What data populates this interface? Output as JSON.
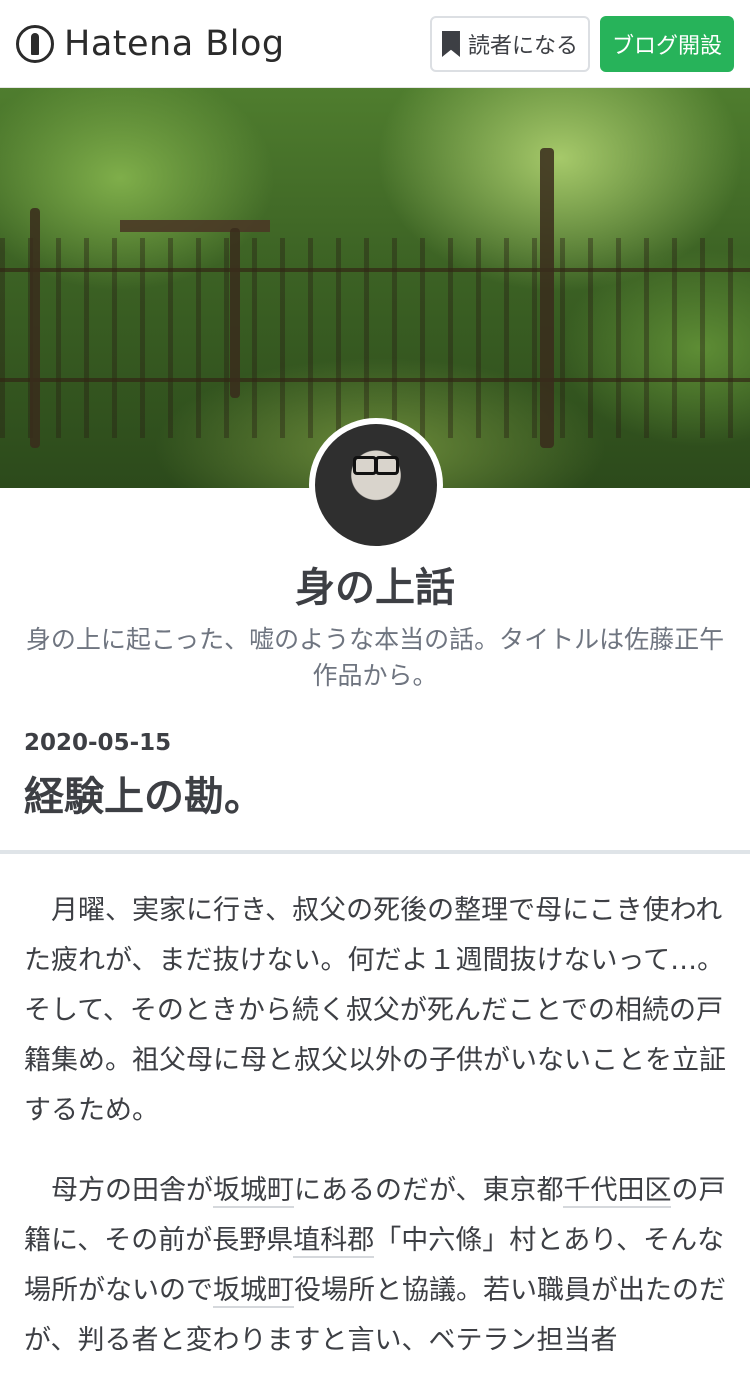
{
  "header": {
    "logo_text": "Hatena Blog",
    "reader_button": "読者になる",
    "open_blog_button": "ブログ開設"
  },
  "blog": {
    "title": "身の上話",
    "description": "身の上に起こった、嘘のような本当の話。タイトルは佐藤正午作品から。"
  },
  "entry": {
    "date": "2020-05-15",
    "title": "経験上の勘。",
    "paragraph1": "月曜、実家に行き、叔父の死後の整理で母にこき使われた疲れが、まだ抜けない。何だよ１週間抜けないって…。そして、そのときから続く叔父が死んだことでの相続の戸籍集め。祖父母に母と叔父以外の子供がいないことを立証するため。",
    "paragraph2": {
      "t1": "母方の田舎が",
      "k1": "坂城町",
      "t2": "にあるのだが、東京都",
      "k2": "千代田区",
      "t3": "の戸籍に、その前が長野県",
      "k3": "埴科郡",
      "t4": "「中六條」村とあり、そんな場所がないので",
      "k4": "坂城町",
      "t5": "役場所と協議。若い職員が出たのだが、判る者と変わりますと言い、ベテラン担当者"
    }
  }
}
